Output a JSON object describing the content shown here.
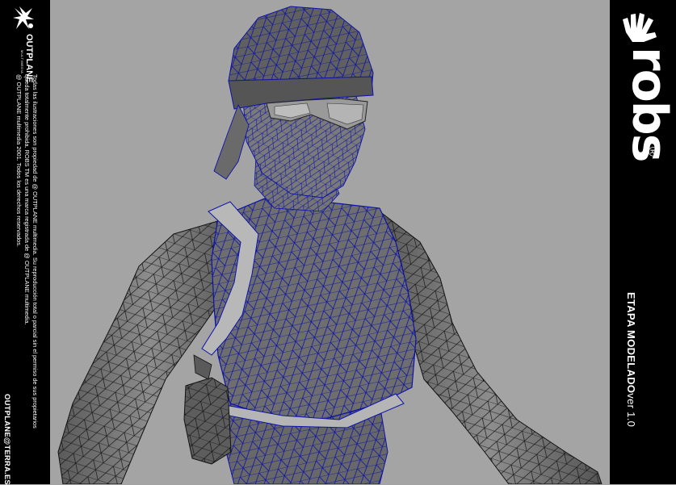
{
  "left_panel": {
    "logo_word": "OUTPLANE",
    "logo_sub": "MULTIMEDIA",
    "legal_lines": [
      "Todas las ilustraciones son propiedad de @ OUTPLANE multimedia. Su reproducción total o parcial sin el permiso de sus propietarios",
      "queda totalmente prohibida. ROBS TM  es una marca registrada de  @ OUTPLANE multimedia.",
      "@ OUTPLANE multimedia 2001. Todos los derechos reservados."
    ],
    "email": "OUTPLANE@TERRA.ES"
  },
  "right_panel": {
    "brand": "robs",
    "registered": "®",
    "stage": "ETAPA MODELADO",
    "version": "ver 1.0"
  },
  "colors": {
    "background": "#a4a4a4",
    "panel": "#000000",
    "model_fill": "#6b6b6b",
    "wireframe_blue": "#0c12a8",
    "wireframe_black": "#111111",
    "strap": "#b8b8b8"
  }
}
